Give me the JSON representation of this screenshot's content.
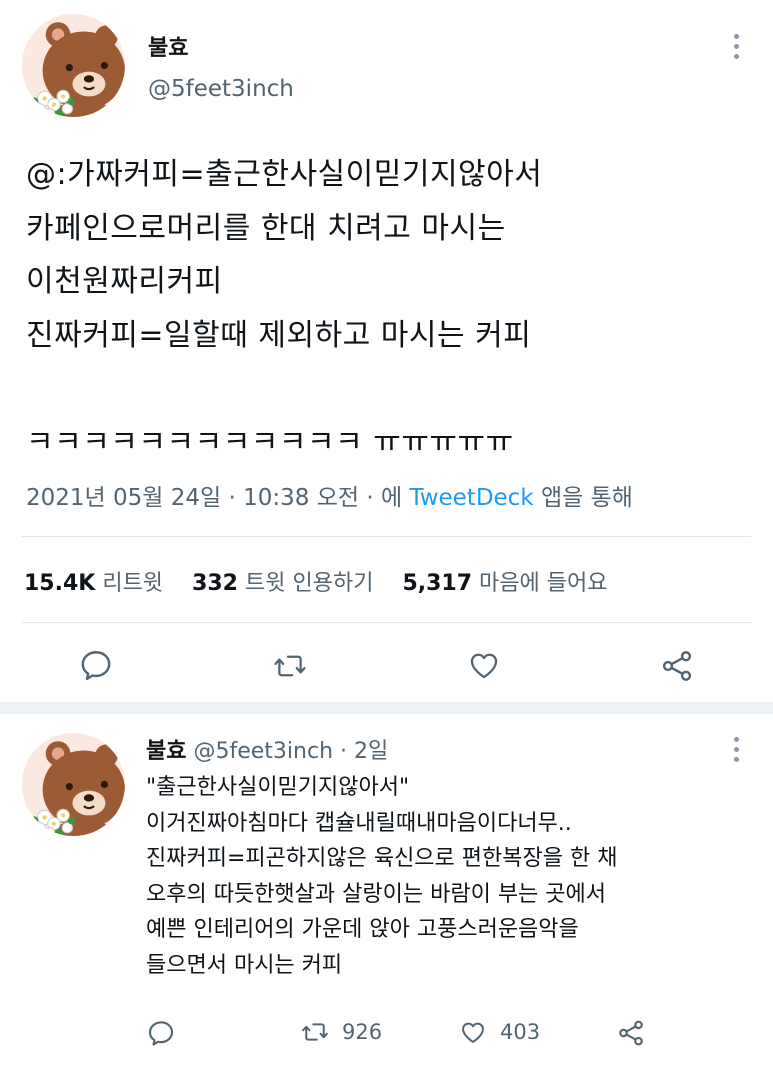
{
  "main_tweet": {
    "display_name": "불효",
    "handle": "@5feet3inch",
    "text": "@:가짜커피=출근한사실이믿기지않아서\n카페인으로머리를 한대 치려고 마시는\n이천원짜리커피\n진짜커피=일할때 제외하고 마시는 커피\n\nㅋㅋㅋㅋㅋㅋㅋㅋㅋㅋㅋㅋ ㅠㅠㅠㅠㅠ",
    "date": "2021년 05월 24일",
    "time": "10:38 오전",
    "dot": "·",
    "via_prefix": "에",
    "source": "TweetDeck",
    "via_suffix": "앱을 통해",
    "stats": {
      "retweets_count": "15.4K",
      "retweets_label": "리트윗",
      "quotes_count": "332",
      "quotes_label": "트윗 인용하기",
      "likes_count": "5,317",
      "likes_label": "마음에 들어요"
    }
  },
  "reply_tweet": {
    "display_name": "불효",
    "handle": "@5feet3inch",
    "dot": "·",
    "time": "2일",
    "text": "\"출근한사실이믿기지않아서\"\n이거진짜아침마다 캡슐내릴때내마음이다너무..\n진짜커피=피곤하지않은 육신으로 편한복장을 한 채\n오후의 따듯한햇살과 살랑이는 바람이 부는 곳에서\n예쁜 인테리어의 가운데 앉아 고풍스러운음악을\n들으면서 마시는 커피",
    "retweet_count": "926",
    "like_count": "403"
  },
  "icons": {
    "reply": "reply-icon",
    "retweet": "retweet-icon",
    "like": "heart-icon",
    "share": "share-icon",
    "more": "more-icon"
  },
  "colors": {
    "link": "#1d9bf0",
    "secondary_text": "#536471",
    "divider": "#e1e6ea",
    "icon": "#536471",
    "avatar_bg": "#fbe9e1",
    "bear_brown": "#9b5b34"
  }
}
